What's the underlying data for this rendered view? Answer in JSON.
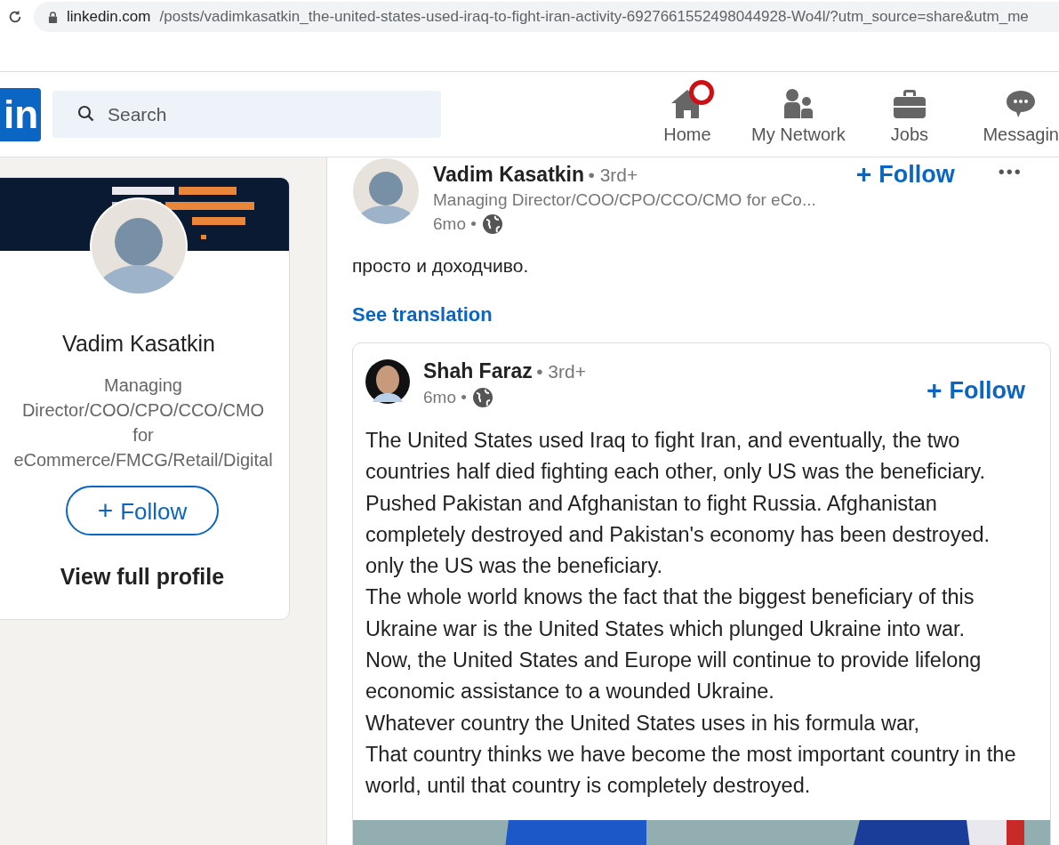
{
  "browser": {
    "url_domain": "linkedin.com",
    "url_path": "/posts/vadimkasatkin_the-united-states-used-iraq-to-fight-iran-activity-6927661552498044928-Wo4l/?utm_source=share&utm_me"
  },
  "header": {
    "logo": "in",
    "search_placeholder": "Search",
    "nav": [
      {
        "kind": "home",
        "label": "Home",
        "badge": true
      },
      {
        "kind": "network",
        "label": "My Network",
        "badge": false
      },
      {
        "kind": "jobs",
        "label": "Jobs",
        "badge": false
      },
      {
        "kind": "messaging",
        "label": "Messagin",
        "badge": false
      }
    ]
  },
  "profile_card": {
    "name": "Vadim Kasatkin",
    "headline": "Managing Director/COO/CPO/CCO/CMO for eCommerce/FMCG/Retail/Digital",
    "follow": "Follow",
    "follow_icon": "+",
    "view_profile": "View full profile"
  },
  "post": {
    "author": "Vadim Kasatkin",
    "degree": "• 3rd+",
    "headline": "Managing Director/COO/CPO/CCO/CMO for eCo...",
    "time": "6mo •",
    "follow": "Follow",
    "follow_icon": "+",
    "more": "•••",
    "text": "просто и доходчиво.",
    "translation_link": "See translation",
    "shared": {
      "author": "Shah Faraz",
      "degree": "• 3rd+",
      "time": "6mo •",
      "follow": "Follow",
      "follow_icon": "+",
      "paragraphs": [
        "The United States used Iraq to fight Iran, and eventually, the two countries half died fighting each other, only US was the beneficiary.",
        "Pushed Pakistan and Afghanistan to fight Russia. Afghanistan completely destroyed and Pakistan's economy has been destroyed. only the US was the beneficiary.",
        "The whole world knows the fact that the biggest beneficiary of this Ukraine war is the United States which plunged Ukraine into war.",
        "Now, the United States and Europe will continue to provide lifelong economic assistance to a wounded Ukraine.",
        "Whatever country the United States uses in his formula war,",
        "That country thinks we have become the most important country in the world, until that country is completely destroyed."
      ]
    }
  }
}
